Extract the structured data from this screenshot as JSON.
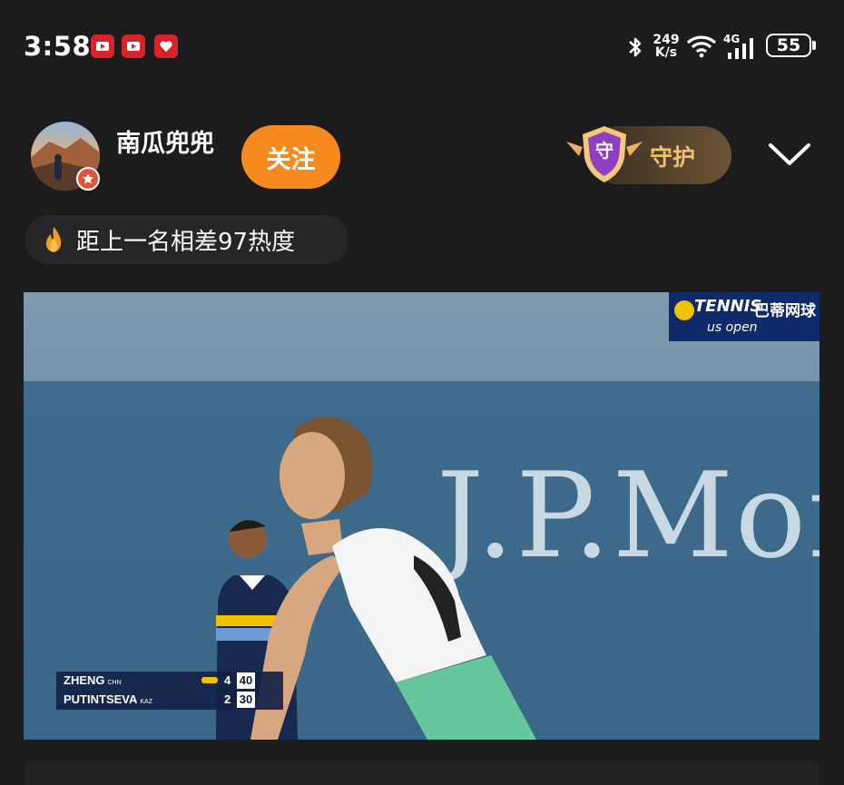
{
  "status_bar": {
    "time": "3:58",
    "net_speed_value": "249",
    "net_speed_unit": "K/s",
    "network": "4G",
    "battery": "55"
  },
  "header": {
    "username": "南瓜兜兜",
    "follow_label": "关注",
    "guard_shield_char": "守",
    "guard_label": "守护"
  },
  "heat": {
    "text": "距上一名相差97热度"
  },
  "video": {
    "sponsor_text": "J.P.Mor",
    "broadcast_logo": {
      "brand": "TENNIS",
      "cn": "巴蒂网球",
      "event": "us open"
    },
    "scoreboard": {
      "players": [
        {
          "name": "ZHENG",
          "country": "CHN",
          "games": "4",
          "points": "40",
          "serving": true
        },
        {
          "name": "PUTINTSEVA",
          "country": "KAZ",
          "games": "2",
          "points": "30",
          "serving": false
        }
      ]
    }
  },
  "colors": {
    "background": "#1c1c1e",
    "follow_button": "#f68a1e",
    "guard_text": "#f0c070"
  }
}
